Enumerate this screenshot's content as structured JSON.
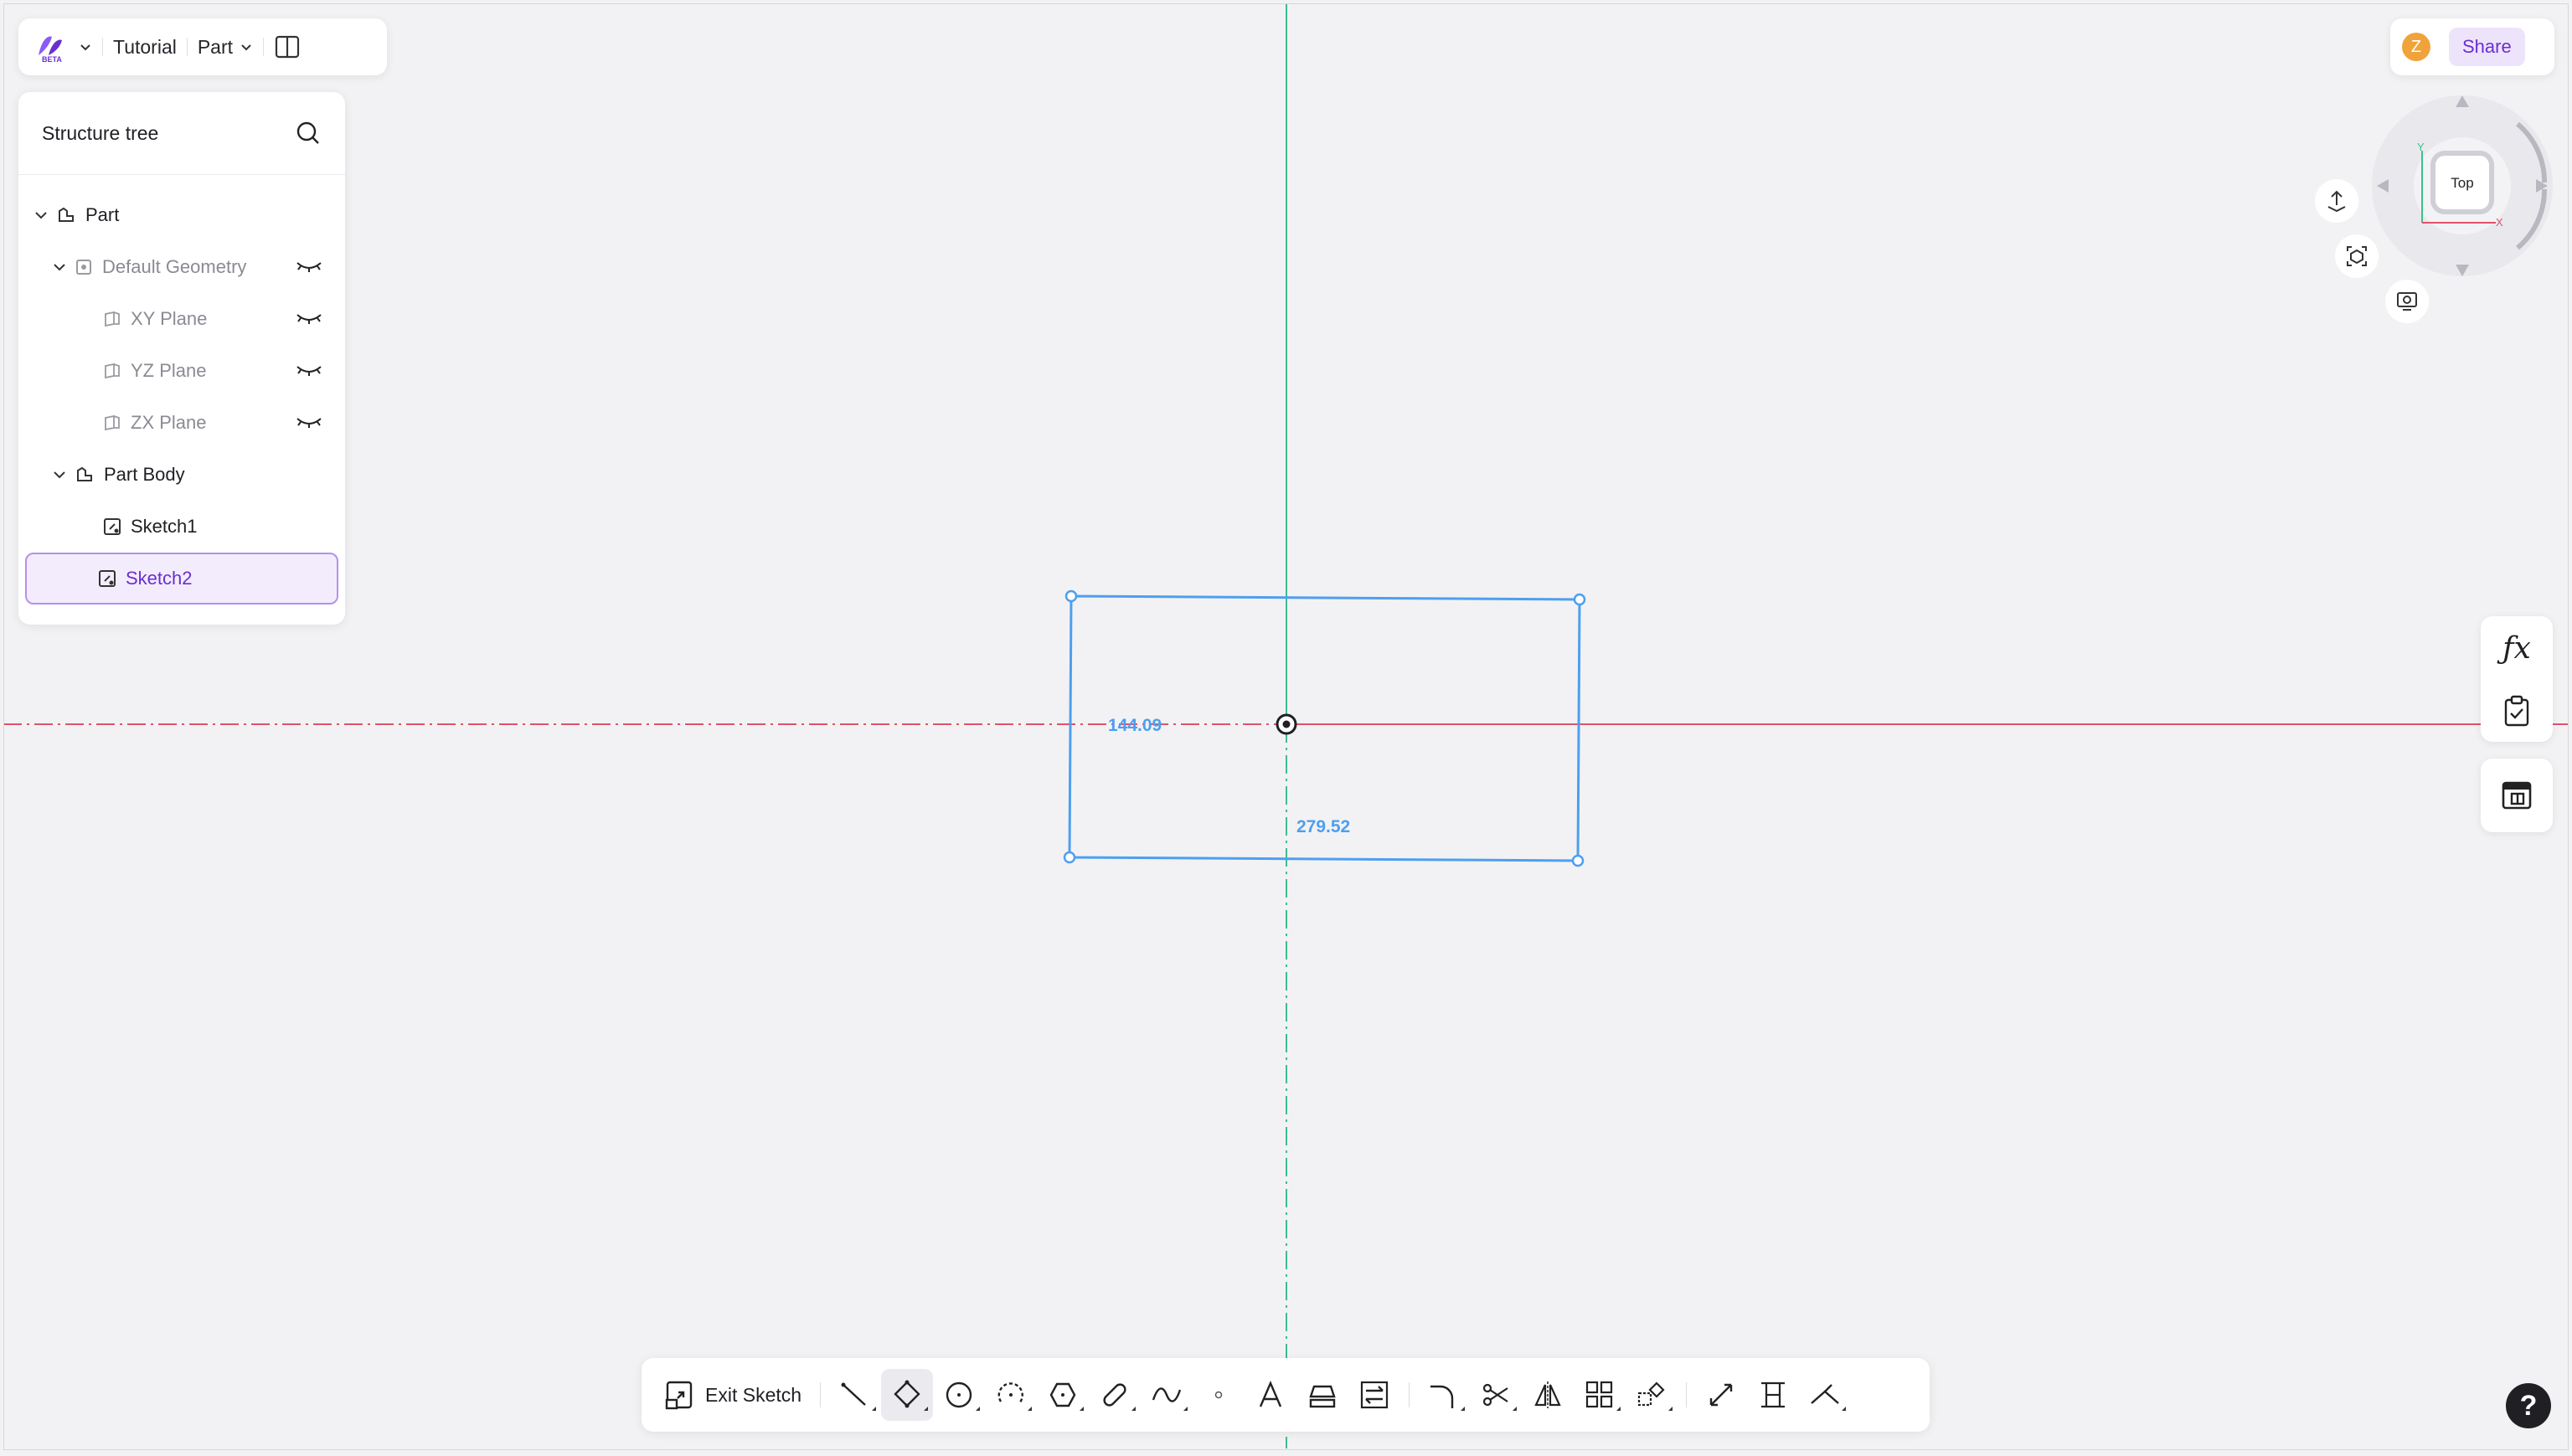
{
  "app": {
    "logo_badge": "BETA",
    "project": "Tutorial",
    "mode": "Part"
  },
  "tree": {
    "title": "Structure tree",
    "items": [
      {
        "label": "Part"
      },
      {
        "label": "Default Geometry"
      },
      {
        "label": "XY Plane"
      },
      {
        "label": "YZ Plane"
      },
      {
        "label": "ZX Plane"
      },
      {
        "label": "Part Body"
      },
      {
        "label": "Sketch1"
      },
      {
        "label": "Sketch2"
      }
    ]
  },
  "header_right": {
    "avatar_initial": "Z",
    "share_label": "Share"
  },
  "viewcube": {
    "face": "Top",
    "axis_x": "X",
    "axis_y": "Y"
  },
  "sketch": {
    "dim_height": "144.09",
    "dim_width": "279.52"
  },
  "bottom_toolbar": {
    "exit_label": "Exit Sketch"
  },
  "help_label": "?",
  "colors": {
    "accent": "#6b2fcf",
    "sketch_blue": "#4d9ff0",
    "axis_red": "#e0516b",
    "axis_green": "#3cbf8e"
  }
}
